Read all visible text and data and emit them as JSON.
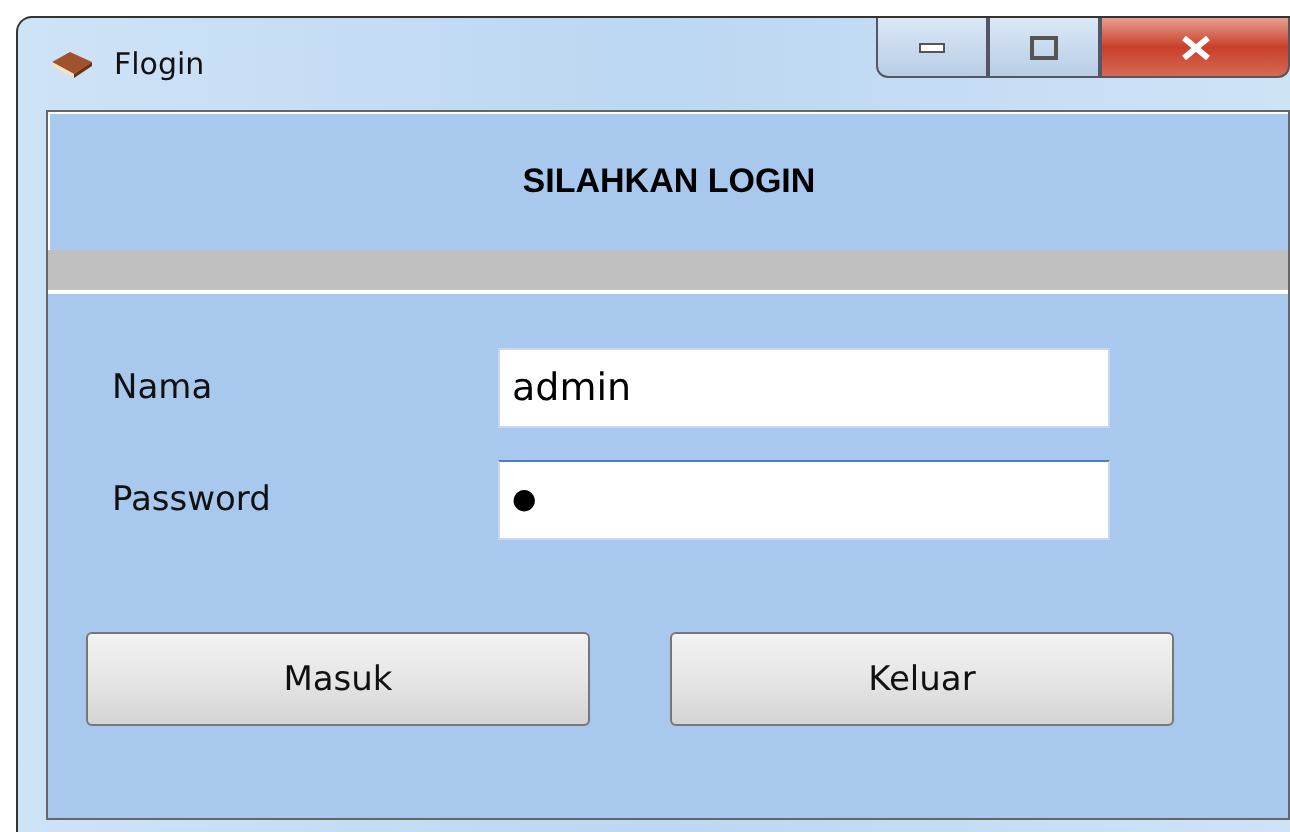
{
  "window": {
    "title": "Flogin"
  },
  "header": {
    "title": "SILAHKAN LOGIN"
  },
  "fields": [
    {
      "label": "Nama",
      "value": "admin"
    },
    {
      "label": "Password",
      "value": "●"
    }
  ],
  "buttons": [
    "Masuk",
    "Keluar"
  ]
}
